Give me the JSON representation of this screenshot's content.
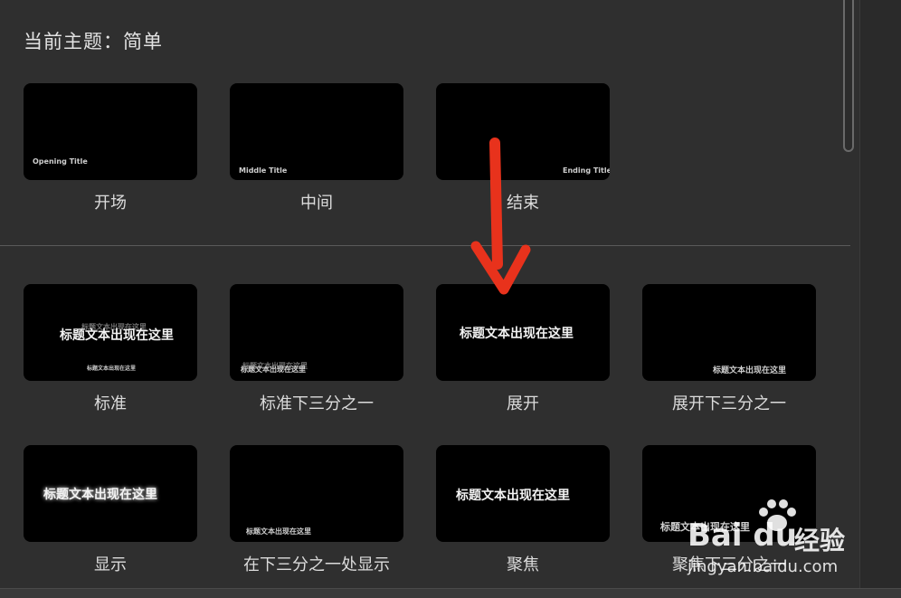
{
  "panel": {
    "theme_title": "当前主题：简单"
  },
  "group1": [
    {
      "label": "开场",
      "thumb_text": "Opening Title"
    },
    {
      "label": "中间",
      "thumb_text": "Middle Title"
    },
    {
      "label": "结束",
      "thumb_text": "Ending Title"
    }
  ],
  "group2": [
    {
      "label": "标准",
      "main": "标题文本出现在这里",
      "ghost": "标题文本出现在这里",
      "sub": "标题文本出现在这里"
    },
    {
      "label": "标准下三分之一",
      "main": "标题文本出现在这里",
      "ghost": "标题文本出现在这里"
    },
    {
      "label": "展开",
      "main": "标题文本出现在这里"
    },
    {
      "label": "展开下三分之一",
      "main": "标题文本出现在这里"
    }
  ],
  "group3": [
    {
      "label": "显示",
      "main": "标题文本出现在这里"
    },
    {
      "label": "在下三分之一处显示",
      "main": "标题文本出现在这里"
    },
    {
      "label": "聚焦",
      "main": "标题文本出现在这里"
    },
    {
      "label": "聚焦下三分之一",
      "main": "标题文本出现在这里"
    }
  ],
  "watermark": {
    "brand": "Bai du",
    "brand2": "经验",
    "url": "jingyan.baidu.com"
  },
  "colors": {
    "background": "#2f2f2f",
    "thumbnail": "#000000",
    "arrow": "#e8321c"
  }
}
